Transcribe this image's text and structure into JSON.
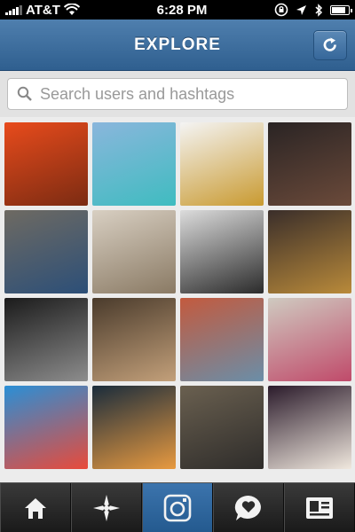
{
  "status_bar": {
    "carrier": "AT&T",
    "time": "6:28 PM",
    "battery_level": 0.85
  },
  "header": {
    "title": "EXPLORE",
    "refresh_icon": "refresh-icon"
  },
  "search": {
    "placeholder": "Search users and hashtags"
  },
  "photos": [
    {
      "name": "photo-orange-phone-case",
      "colors": [
        "#e84b1c",
        "#7b2b12"
      ]
    },
    {
      "name": "photo-beach",
      "colors": [
        "#8ab6dc",
        "#3fbcc0"
      ]
    },
    {
      "name": "photo-jewelry-phone",
      "colors": [
        "#f4f4f4",
        "#c99a30"
      ]
    },
    {
      "name": "photo-woman-portrait",
      "colors": [
        "#2a2424",
        "#6b4a3a"
      ]
    },
    {
      "name": "photo-laptop-room",
      "colors": [
        "#6e6a62",
        "#2c4f78"
      ]
    },
    {
      "name": "photo-braid",
      "colors": [
        "#d8cfc2",
        "#8a7a64"
      ]
    },
    {
      "name": "photo-woman-bw",
      "colors": [
        "#dcdcdc",
        "#2b2b2b"
      ]
    },
    {
      "name": "photo-gold-dress",
      "colors": [
        "#3a2e2a",
        "#b98a3a"
      ]
    },
    {
      "name": "photo-concert",
      "colors": [
        "#1b1b1b",
        "#8d8d8d"
      ]
    },
    {
      "name": "photo-group-street",
      "colors": [
        "#4a3b2c",
        "#c3a07a"
      ]
    },
    {
      "name": "photo-colorful-buildings",
      "colors": [
        "#c35a3e",
        "#6a8ea8"
      ]
    },
    {
      "name": "photo-woman-street",
      "colors": [
        "#cfcac0",
        "#c04a6a"
      ]
    },
    {
      "name": "photo-rainbow-cupcakes",
      "colors": [
        "#2a8fd6",
        "#e94a3a"
      ]
    },
    {
      "name": "photo-cartoon-screen",
      "colors": [
        "#1a2c3c",
        "#e89a40"
      ]
    },
    {
      "name": "photo-group-men",
      "colors": [
        "#6a6050",
        "#2e2c2a"
      ]
    },
    {
      "name": "photo-sweet-dreams",
      "colors": [
        "#2b1b2b",
        "#f0e8de"
      ]
    }
  ],
  "tabbar": {
    "tabs": [
      {
        "name": "home",
        "icon": "home-icon"
      },
      {
        "name": "explore",
        "icon": "compass-icon"
      },
      {
        "name": "camera",
        "icon": "camera-icon",
        "active": true
      },
      {
        "name": "activity",
        "icon": "heart-bubble-icon"
      },
      {
        "name": "profile",
        "icon": "profile-card-icon"
      }
    ]
  }
}
